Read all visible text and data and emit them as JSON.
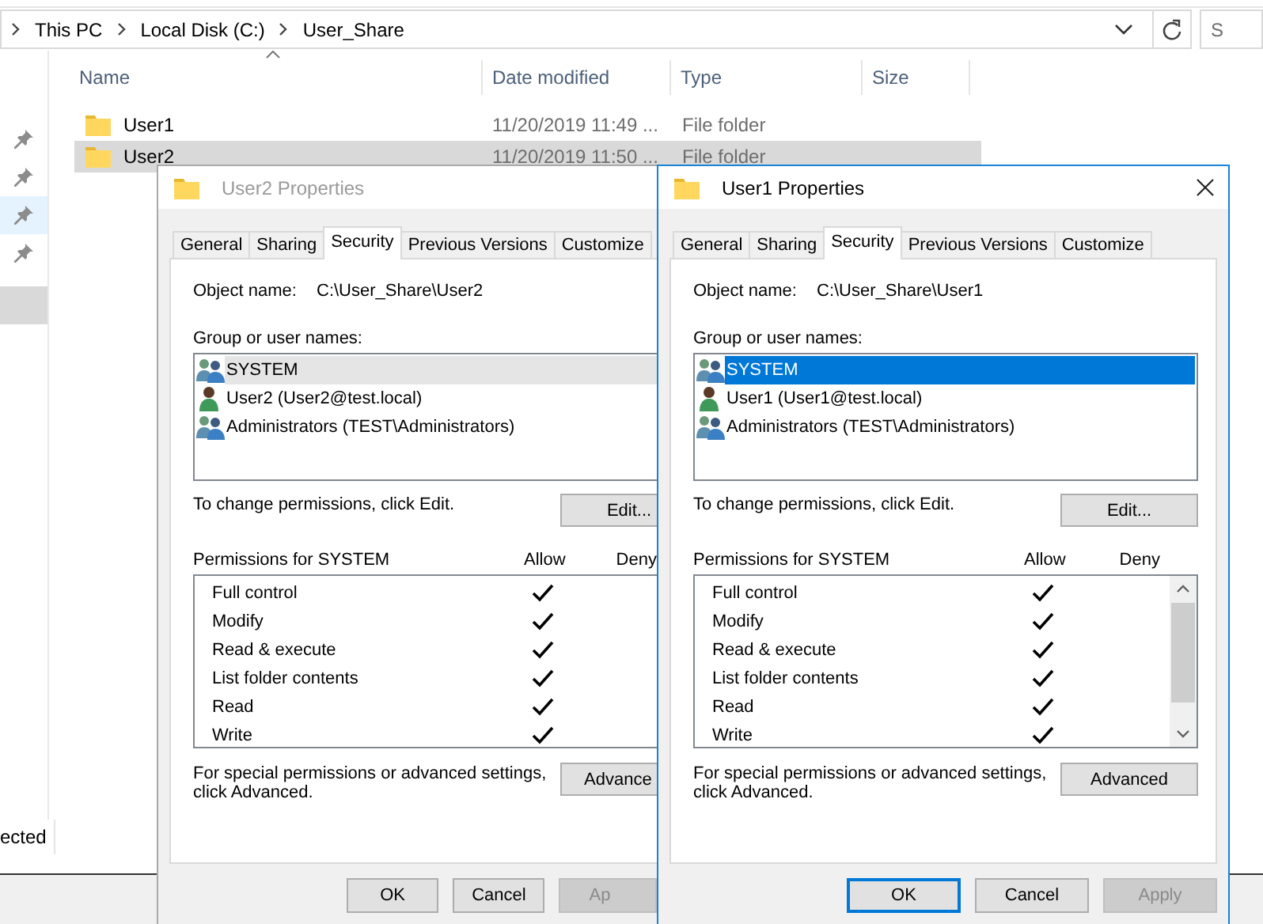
{
  "explorer": {
    "breadcrumbs": [
      "This PC",
      "Local Disk (C:)",
      "User_Share"
    ],
    "search_placeholder": "S",
    "nav_items": [
      {
        "pinned": true,
        "hovered": false,
        "selected": false
      },
      {
        "pinned": true,
        "hovered": false,
        "selected": false
      },
      {
        "pinned": true,
        "hovered": true,
        "selected": false
      },
      {
        "pinned": true,
        "hovered": false,
        "selected": false
      },
      {
        "pinned": false,
        "hovered": false,
        "selected": true
      }
    ],
    "columns": [
      "Name",
      "Date modified",
      "Type",
      "Size"
    ],
    "files": [
      {
        "name": "User1",
        "date": "11/20/2019 11:49 ...",
        "type": "File folder",
        "selected": false
      },
      {
        "name": "User2",
        "date": "11/20/2019 11:50 ...",
        "type": "File folder",
        "selected": true
      }
    ],
    "status": "ected"
  },
  "dialogs": [
    {
      "title": "User2 Properties",
      "active": false,
      "tabs": [
        {
          "label": "General",
          "selected": false
        },
        {
          "label": "Sharing",
          "selected": false
        },
        {
          "label": "Security",
          "selected": true
        },
        {
          "label": "Previous Versions",
          "selected": false
        },
        {
          "label": "Customize",
          "selected": false
        }
      ],
      "object_label": "Object name:",
      "object_name": "C:\\User_Share\\User2",
      "group_label": "Group or user names:",
      "principals": [
        {
          "name": "SYSTEM",
          "kind": "group",
          "selected": true
        },
        {
          "name": "User2 (User2@test.local)",
          "kind": "user",
          "selected": false
        },
        {
          "name": "Administrators (TEST\\Administrators)",
          "kind": "group",
          "selected": false
        }
      ],
      "change_hint": "To change permissions, click Edit.",
      "edit_button": "Edit...",
      "permissions_label": "Permissions for SYSTEM",
      "allow_label": "Allow",
      "deny_label": "Deny",
      "permissions": [
        {
          "name": "Full control",
          "allow": true
        },
        {
          "name": "Modify",
          "allow": true
        },
        {
          "name": "Read & execute",
          "allow": true
        },
        {
          "name": "List folder contents",
          "allow": true
        },
        {
          "name": "Read",
          "allow": true
        },
        {
          "name": "Write",
          "allow": true
        }
      ],
      "advanced_hint": "For special permissions or advanced settings,\nclick Advanced.",
      "advanced_button": "Advance",
      "buttons": [
        {
          "label": "OK",
          "focused": false,
          "disabled": false
        },
        {
          "label": "Cancel",
          "focused": false,
          "disabled": false
        },
        {
          "label": "Ap",
          "focused": false,
          "disabled": true
        }
      ]
    },
    {
      "title": "User1 Properties",
      "active": true,
      "tabs": [
        {
          "label": "General",
          "selected": false
        },
        {
          "label": "Sharing",
          "selected": false
        },
        {
          "label": "Security",
          "selected": true
        },
        {
          "label": "Previous Versions",
          "selected": false
        },
        {
          "label": "Customize",
          "selected": false
        }
      ],
      "object_label": "Object name:",
      "object_name": "C:\\User_Share\\User1",
      "group_label": "Group or user names:",
      "principals": [
        {
          "name": "SYSTEM",
          "kind": "group",
          "selected": true
        },
        {
          "name": "User1 (User1@test.local)",
          "kind": "user",
          "selected": false
        },
        {
          "name": "Administrators (TEST\\Administrators)",
          "kind": "group",
          "selected": false
        }
      ],
      "change_hint": "To change permissions, click Edit.",
      "edit_button": "Edit...",
      "permissions_label": "Permissions for SYSTEM",
      "allow_label": "Allow",
      "deny_label": "Deny",
      "permissions": [
        {
          "name": "Full control",
          "allow": true
        },
        {
          "name": "Modify",
          "allow": true
        },
        {
          "name": "Read & execute",
          "allow": true
        },
        {
          "name": "List folder contents",
          "allow": true
        },
        {
          "name": "Read",
          "allow": true
        },
        {
          "name": "Write",
          "allow": true
        }
      ],
      "advanced_hint": "For special permissions or advanced settings,\nclick Advanced.",
      "advanced_button": "Advanced",
      "buttons": [
        {
          "label": "OK",
          "focused": true,
          "disabled": false
        },
        {
          "label": "Cancel",
          "focused": false,
          "disabled": false
        },
        {
          "label": "Apply",
          "focused": false,
          "disabled": true
        }
      ]
    }
  ]
}
